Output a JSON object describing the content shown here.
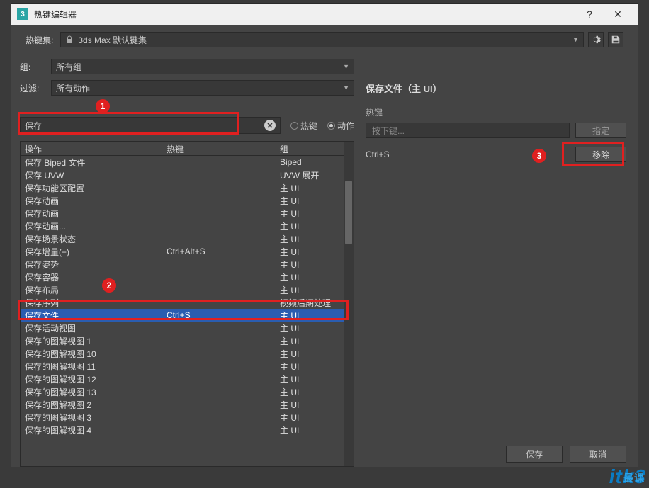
{
  "window": {
    "title": "热键编辑器"
  },
  "preset": {
    "label": "热键集:",
    "value": "3ds Max 默认键集"
  },
  "group": {
    "label": "组:",
    "value": "所有组"
  },
  "filter": {
    "label": "过滤:",
    "value": "所有动作"
  },
  "search": {
    "value": "保存"
  },
  "radios": {
    "hotkey_label": "热键",
    "action_label": "动作"
  },
  "columns": {
    "action": "操作",
    "hotkey": "热键",
    "group": "组"
  },
  "rows": [
    {
      "action": "保存 Biped 文件",
      "hotkey": "",
      "group": "Biped"
    },
    {
      "action": "保存 UVW",
      "hotkey": "",
      "group": "UVW 展开"
    },
    {
      "action": "保存功能区配置",
      "hotkey": "",
      "group": "主 UI"
    },
    {
      "action": "保存动画",
      "hotkey": "",
      "group": "主 UI"
    },
    {
      "action": "保存动画",
      "hotkey": "",
      "group": "主 UI"
    },
    {
      "action": "保存动画...",
      "hotkey": "",
      "group": "主 UI"
    },
    {
      "action": "保存场景状态",
      "hotkey": "",
      "group": "主 UI"
    },
    {
      "action": "保存增量(+)",
      "hotkey": "Ctrl+Alt+S",
      "group": "主 UI"
    },
    {
      "action": "保存姿势",
      "hotkey": "",
      "group": "主 UI"
    },
    {
      "action": "保存容器",
      "hotkey": "",
      "group": "主 UI"
    },
    {
      "action": "保存布局",
      "hotkey": "",
      "group": "主 UI"
    },
    {
      "action": "保存序列",
      "hotkey": "",
      "group": "视频后期处理"
    },
    {
      "action": "保存文件",
      "hotkey": "Ctrl+S",
      "group": "主 UI"
    },
    {
      "action": "保存活动视图",
      "hotkey": "",
      "group": "主 UI"
    },
    {
      "action": "保存的图解视图 1",
      "hotkey": "",
      "group": "主 UI"
    },
    {
      "action": "保存的图解视图 10",
      "hotkey": "",
      "group": "主 UI"
    },
    {
      "action": "保存的图解视图 11",
      "hotkey": "",
      "group": "主 UI"
    },
    {
      "action": "保存的图解视图 12",
      "hotkey": "",
      "group": "主 UI"
    },
    {
      "action": "保存的图解视图 13",
      "hotkey": "",
      "group": "主 UI"
    },
    {
      "action": "保存的图解视图 2",
      "hotkey": "",
      "group": "主 UI"
    },
    {
      "action": "保存的图解视图 3",
      "hotkey": "",
      "group": "主 UI"
    },
    {
      "action": "保存的图解视图 4",
      "hotkey": "",
      "group": "主 UI"
    }
  ],
  "selected_index": 12,
  "right": {
    "title": "保存文件（主 UI）",
    "group_label": "热键",
    "placeholder": "按下键...",
    "assign_btn": "指定",
    "assigned_key": "Ctrl+S",
    "remove_btn": "移除"
  },
  "footer": {
    "save": "保存",
    "cancel": "取消"
  },
  "annotations": {
    "b1": "1",
    "b2": "2",
    "b3": "3"
  },
  "watermark": {
    "text": "itk3",
    "cn": "最课"
  }
}
